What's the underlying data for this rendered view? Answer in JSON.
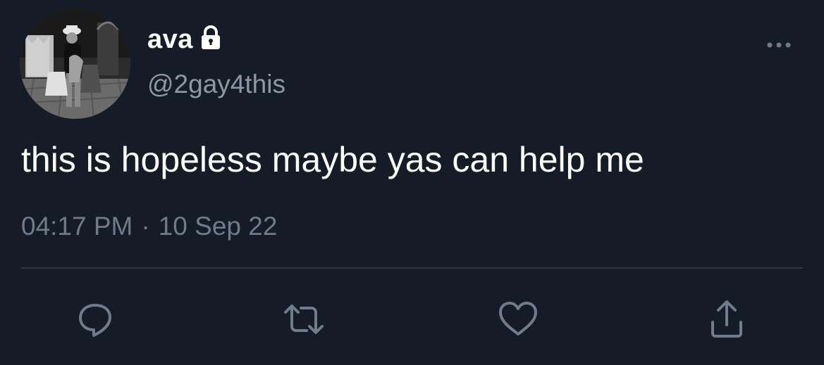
{
  "author": {
    "display_name": "ava",
    "handle": "@2gay4this",
    "protected_icon": "lock-icon",
    "avatar": "avatar-photo"
  },
  "tweet": {
    "text": "this is hopeless maybe yas can help me",
    "time": "04:17 PM",
    "separator": "·",
    "date": "10 Sep 22"
  },
  "actions": {
    "more": "more-dots-icon",
    "reply": "reply-icon",
    "retweet": "retweet-icon",
    "like": "heart-icon",
    "share": "share-icon"
  },
  "colors": {
    "background": "#151c27",
    "primary_text": "#ffffff",
    "secondary_text": "#8b98a5",
    "icon": "#6e7c8c",
    "divider": "#2c3641"
  }
}
